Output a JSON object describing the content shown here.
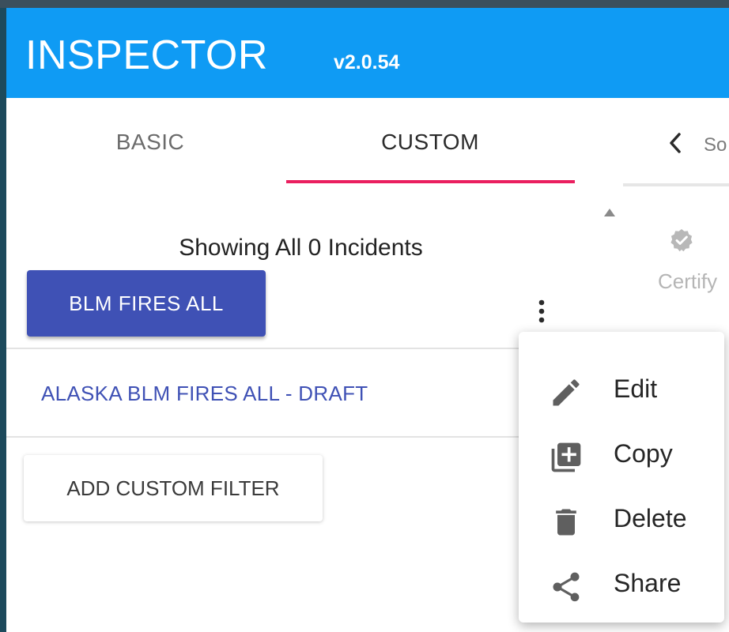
{
  "header": {
    "title": "INSPECTOR",
    "version": "v2.0.54",
    "background_color": "#0f9bf4"
  },
  "tabs": [
    {
      "label": "BASIC",
      "selected": false
    },
    {
      "label": "CUSTOM",
      "selected": true
    }
  ],
  "tab_indicator_color": "#ea1f5f",
  "right_pane": {
    "tab_text": "So",
    "back_icon": "chevron-left-icon",
    "certify_icon": "verified-badge-icon",
    "certify_label": "Certify"
  },
  "panel": {
    "incident_count_text": "Showing All 0 Incidents",
    "primary_button_label": "BLM FIRES ALL",
    "primary_button_color": "#3f51b5",
    "filters": [
      {
        "label": "ALASKA BLM FIRES ALL - DRAFT"
      }
    ],
    "add_filter_label": "ADD CUSTOM FILTER",
    "more_icon": "more-vertical-icon"
  },
  "context_menu": {
    "items": [
      {
        "label": "Edit",
        "icon": "pencil-icon"
      },
      {
        "label": "Copy",
        "icon": "copy-icon"
      },
      {
        "label": "Delete",
        "icon": "trash-icon"
      },
      {
        "label": "Share",
        "icon": "share-icon"
      }
    ]
  }
}
